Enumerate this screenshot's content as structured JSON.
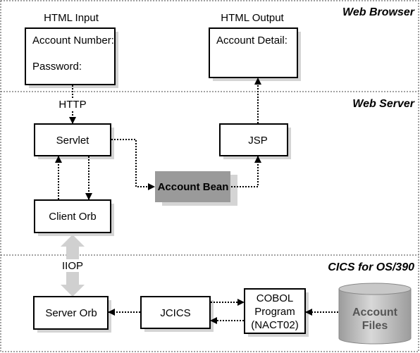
{
  "zones": {
    "browser": "Web Browser",
    "server": "Web Server",
    "cics": "CICS for OS/390"
  },
  "browser": {
    "input_title": "HTML Input",
    "input_fields": [
      "Account Number:",
      "Password:"
    ],
    "output_title": "HTML Output",
    "output_fields": [
      "Account Detail:"
    ]
  },
  "web_server": {
    "http": "HTTP",
    "servlet": "Servlet",
    "jsp": "JSP",
    "account_bean": "Account Bean",
    "client_orb": "Client Orb"
  },
  "cics": {
    "iiop": "IIOP",
    "server_orb": "Server Orb",
    "jcics": "JCICS",
    "cobol": [
      "COBOL",
      "Program",
      "(NACT02)"
    ],
    "files": [
      "Account",
      "Files"
    ]
  },
  "colors": {
    "bean_fill": "#9a9a9a",
    "iiop_arrow": "#d0d0d0",
    "cylinder": "#b5b5b5",
    "files_text": "#555555"
  }
}
